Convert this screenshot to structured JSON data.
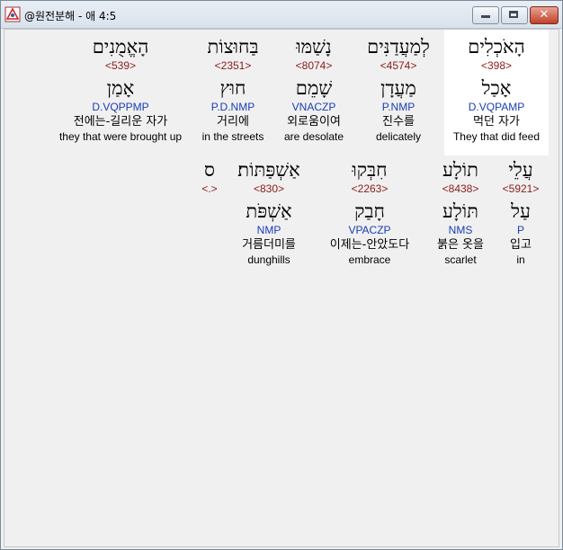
{
  "window": {
    "title": "@원전분해 - 애 4:5",
    "minimize_icon": "minimize-icon",
    "maximize_icon": "maximize-icon",
    "close_icon": "close-icon",
    "close_label": "✕"
  },
  "row1": [
    {
      "word": "הָאֹכְלִים",
      "strong": "<398>",
      "lemma": "אָכַל",
      "morph": "D.VQPAMP",
      "kor": "먹던 자가",
      "eng": "They that did feed"
    },
    {
      "word": "לְמַעֲדַנִּים",
      "strong": "<4574>",
      "lemma": "מַעֲדָן",
      "morph": "P.NMP",
      "kor": "진수를",
      "eng": "delicately"
    },
    {
      "word": "נָשַׁמּוּ",
      "strong": "<8074>",
      "lemma": "שָׁמֵם",
      "morph": "VNACZP",
      "kor": "외로움이여",
      "eng": "are desolate"
    },
    {
      "word": "בַּחוּצוֹת",
      "strong": "<2351>",
      "lemma": "חוּץ",
      "morph": "P.D.NMP",
      "kor": "거리에",
      "eng": "in the streets"
    },
    {
      "word": "הָאֱמֻנִים",
      "strong": "<539>",
      "lemma": "אָמַן",
      "morph": "D.VQPPMP",
      "kor": "전에는-길리운 자가",
      "eng": "they that were brought up"
    }
  ],
  "row2": [
    {
      "word": "עֲלֵי",
      "strong": "<5921>",
      "lemma": "עַל",
      "morph": "P",
      "kor": "입고",
      "eng": "in"
    },
    {
      "word": "תוֹלָע",
      "strong": "<8438>",
      "lemma": "תּוֹלָע",
      "morph": "NMS",
      "kor": "붉은 옷을",
      "eng": "scarlet"
    },
    {
      "word": "חִבְּקוּ",
      "strong": "<2263>",
      "lemma": "חָבַק",
      "morph": "VPACZP",
      "kor": "이제는-안았도다",
      "eng": "embrace"
    },
    {
      "word": "אַשְׁפַּתּוֹת׃",
      "strong": "<830>",
      "lemma": "אַשְׁפֹּת",
      "morph": "NMP",
      "kor": "거름더미를",
      "eng": "dunghills"
    },
    {
      "word": "ס",
      "strong": "<.>",
      "lemma": "",
      "morph": "",
      "kor": "",
      "eng": ""
    }
  ]
}
